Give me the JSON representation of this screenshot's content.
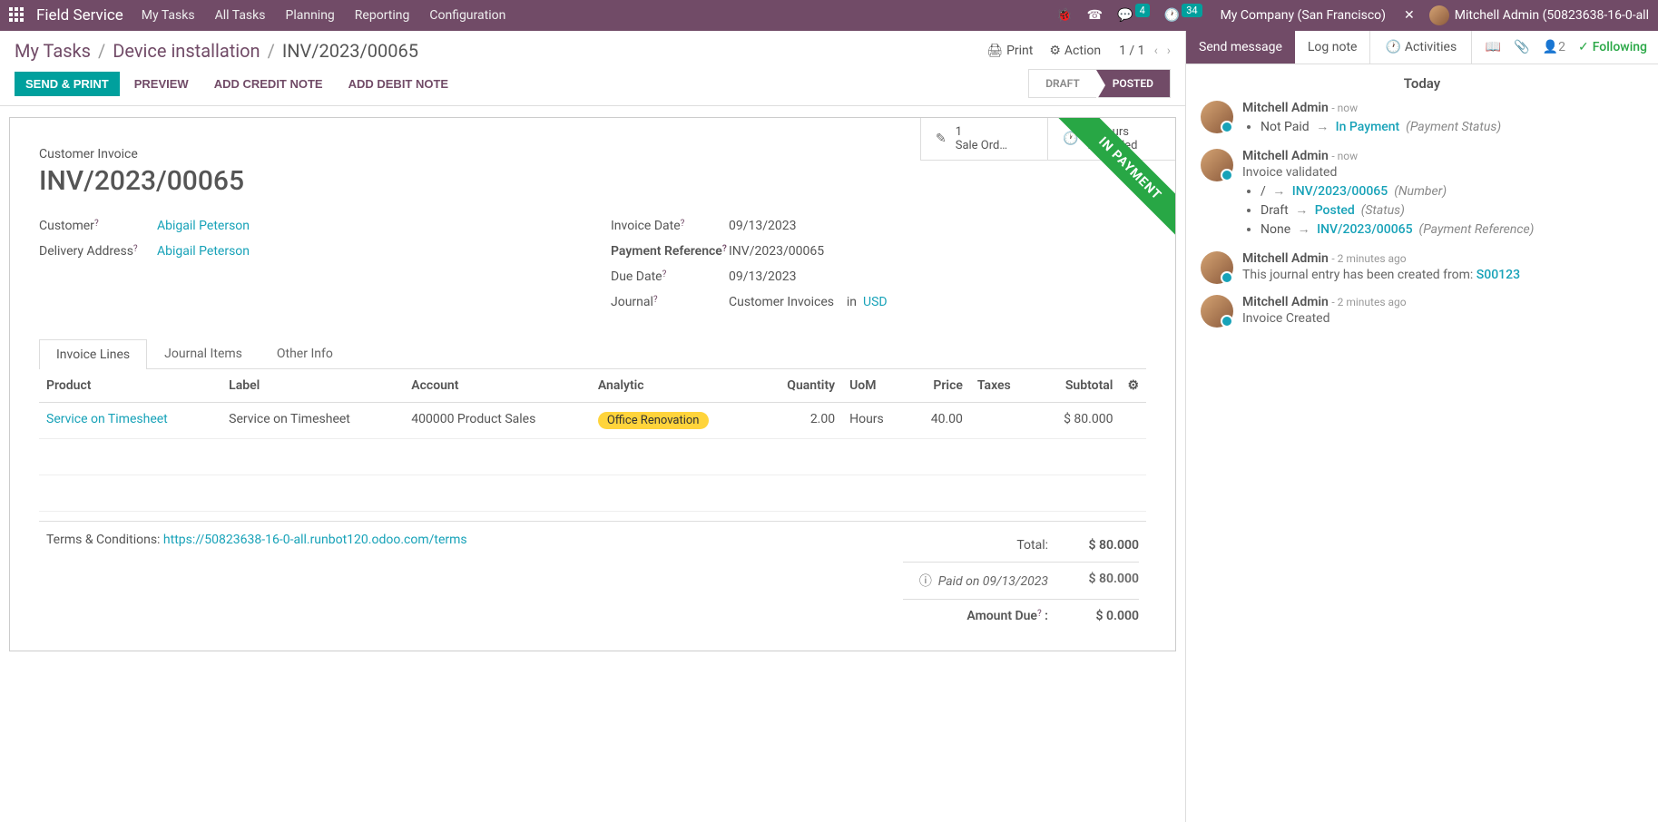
{
  "navbar": {
    "brand": "Field Service",
    "menu": [
      "My Tasks",
      "All Tasks",
      "Planning",
      "Reporting",
      "Configuration"
    ],
    "msgBadge": "4",
    "activityBadge": "34",
    "company": "My Company (San Francisco)",
    "user": "Mitchell Admin (50823638-16-0-all"
  },
  "breadcrumb": {
    "c1": "My Tasks",
    "c2": "Device installation",
    "current": "INV/2023/00065"
  },
  "controls": {
    "print": "Print",
    "action": "Action",
    "pager": "1 / 1"
  },
  "buttons": {
    "send": "SEND & PRINT",
    "preview": "PREVIEW",
    "credit": "ADD CREDIT NOTE",
    "debit": "ADD DEBIT NOTE"
  },
  "status": {
    "draft": "DRAFT",
    "posted": "POSTED"
  },
  "stats": {
    "sale_num": "1",
    "sale_label": "Sale Ord…",
    "hours_num": "2 Hours",
    "hours_label": "Recorded"
  },
  "ribbon": "IN PAYMENT",
  "doc": {
    "subtitle": "Customer Invoice",
    "title": "INV/2023/00065",
    "customer_label": "Customer",
    "customer_value": "Abigail Peterson",
    "delivery_label": "Delivery Address",
    "delivery_value": "Abigail Peterson",
    "invdate_label": "Invoice Date",
    "invdate_value": "09/13/2023",
    "payref_label": "Payment Reference",
    "payref_value": "INV/2023/00065",
    "duedate_label": "Due Date",
    "duedate_value": "09/13/2023",
    "journal_label": "Journal",
    "journal_value": "Customer Invoices",
    "journal_in": "in",
    "journal_currency": "USD"
  },
  "tabs": {
    "lines": "Invoice Lines",
    "items": "Journal Items",
    "other": "Other Info"
  },
  "table": {
    "headers": {
      "product": "Product",
      "label": "Label",
      "account": "Account",
      "analytic": "Analytic",
      "quantity": "Quantity",
      "uom": "UoM",
      "price": "Price",
      "taxes": "Taxes",
      "subtotal": "Subtotal"
    },
    "row": {
      "product": "Service on Timesheet",
      "label": "Service on Timesheet",
      "account": "400000 Product Sales",
      "analytic": "Office Renovation",
      "quantity": "2.00",
      "uom": "Hours",
      "price": "40.00",
      "subtotal": "$ 80.000"
    }
  },
  "terms": {
    "label": "Terms & Conditions: ",
    "link": "https://50823638-16-0-all.runbot120.odoo.com/terms"
  },
  "totals": {
    "total_label": "Total:",
    "total_value": "$ 80.000",
    "paid_label": "Paid on 09/13/2023",
    "paid_value": "$ 80.000",
    "due_label": "Amount Due",
    "due_colon": " :",
    "due_value": "$ 0.000"
  },
  "chatter": {
    "send": "Send message",
    "log": "Log note",
    "activities": "Activities",
    "followers": "2",
    "following": "Following",
    "today": "Today",
    "msgs": [
      {
        "author": "Mitchell Admin",
        "time": "now",
        "items": [
          {
            "old": "Not Paid",
            "new": "In Payment",
            "field": "(Payment Status)"
          }
        ]
      },
      {
        "author": "Mitchell Admin",
        "time": "now",
        "text": "Invoice validated",
        "items": [
          {
            "old": "/",
            "new": "INV/2023/00065",
            "field": "(Number)"
          },
          {
            "old": "Draft",
            "new": "Posted",
            "field": "(Status)"
          },
          {
            "old": "None",
            "new": "INV/2023/00065",
            "field": "(Payment Reference)"
          }
        ]
      },
      {
        "author": "Mitchell Admin",
        "time": "2 minutes ago",
        "text_pre": "This journal entry has been created from: ",
        "link": "S00123"
      },
      {
        "author": "Mitchell Admin",
        "time": "2 minutes ago",
        "text": "Invoice Created"
      }
    ]
  }
}
